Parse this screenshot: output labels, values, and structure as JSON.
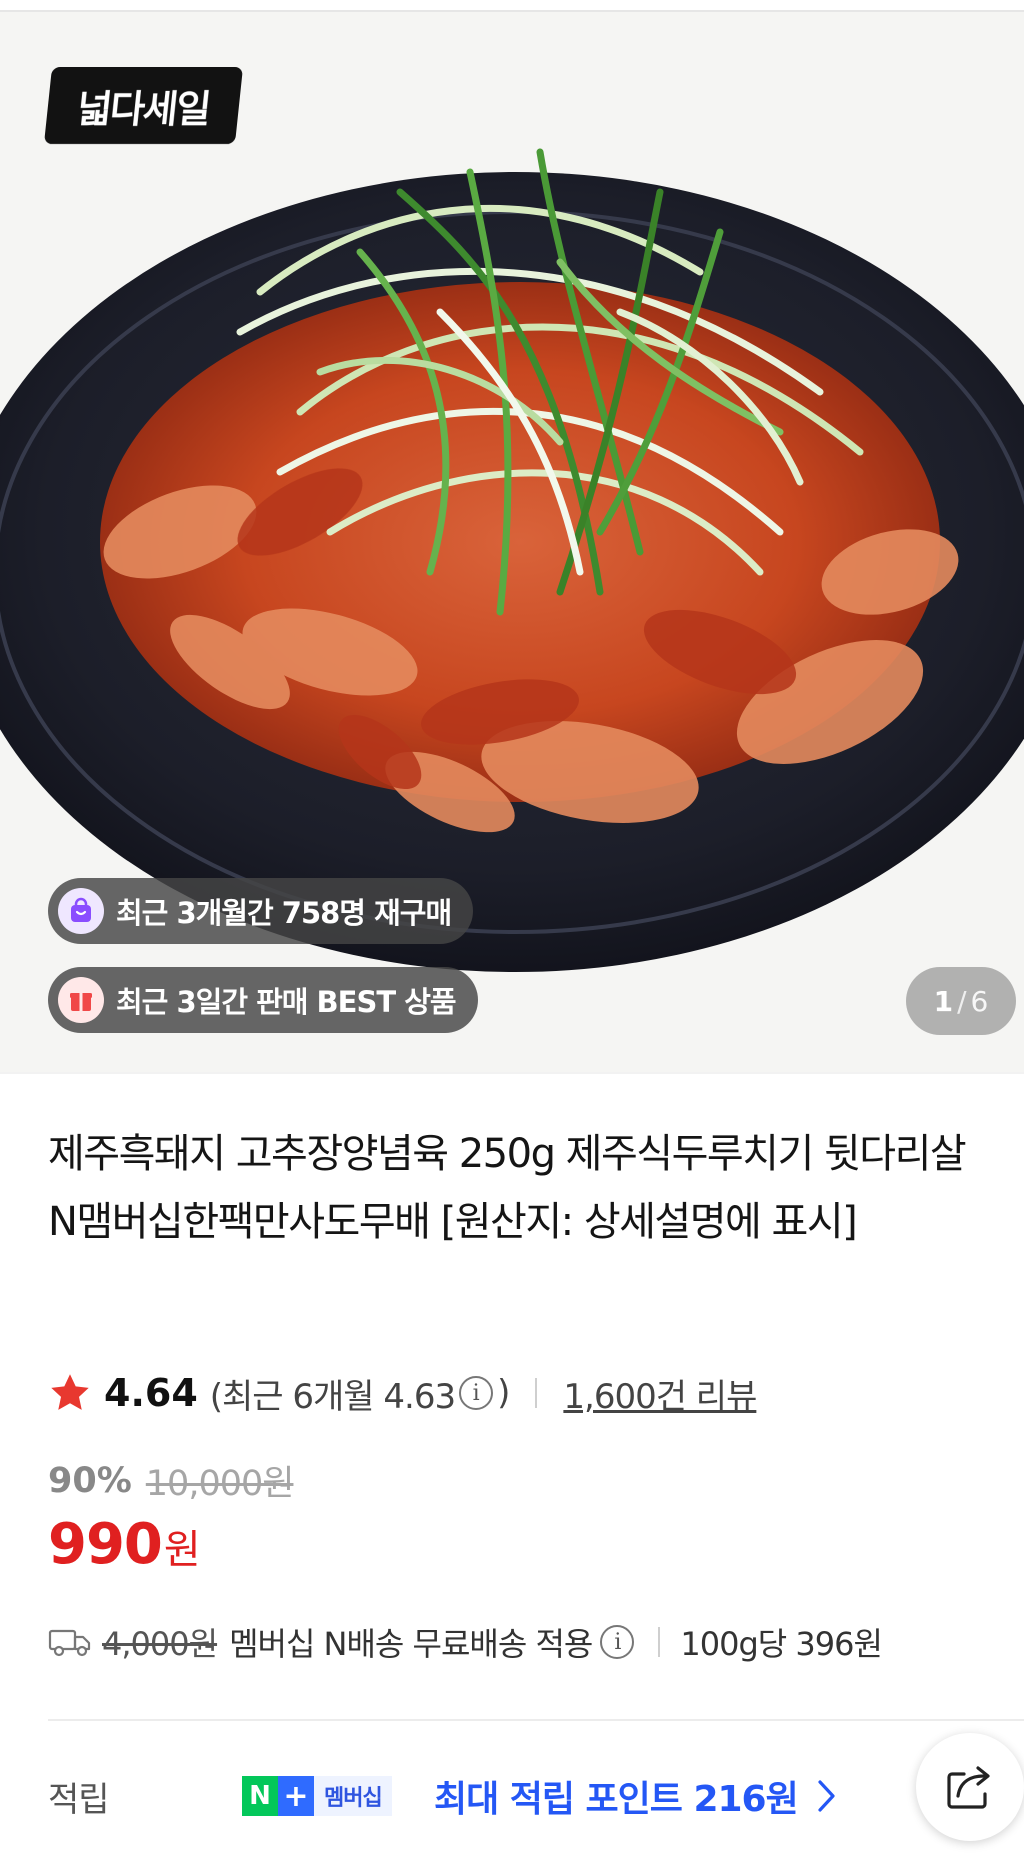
{
  "hero": {
    "sale_logo": "넓다세일",
    "badges": [
      {
        "icon": "shopping-bag-icon",
        "text": "최근 3개월간 758명 재구매"
      },
      {
        "icon": "gift-box-icon",
        "text": "최근 3일간 판매 BEST 상품"
      }
    ],
    "counter": {
      "current": "1",
      "separator": "/",
      "total": "6"
    }
  },
  "product": {
    "title": "제주흑돼지 고추장양념육 250g 제주식두루치기 뒷다리살 N맴버십한팩만사도무배 [원산지: 상세설명에 표시]",
    "rating": "4.64",
    "recent_rating_prefix": "(최근 6개월 4.63",
    "recent_rating_suffix": ")",
    "info_glyph": "i",
    "review_count": "1,600건 리뷰",
    "discount": "90%",
    "original_price": "10,000원",
    "price": "990",
    "price_unit": "원"
  },
  "shipping": {
    "original_fee": "4,000원",
    "text": "멤버십 N배송 무료배송 적용",
    "unit_price": "100g당 396원"
  },
  "points": {
    "label": "적립",
    "badge_n": "N",
    "badge_plus": "+",
    "badge_member": "멤버십",
    "text": "최대 적립 포인트 216원"
  },
  "colors": {
    "price_red": "#e02020",
    "points_blue": "#2457f5",
    "naver_green": "#03c75a",
    "star": "#e8382f"
  }
}
